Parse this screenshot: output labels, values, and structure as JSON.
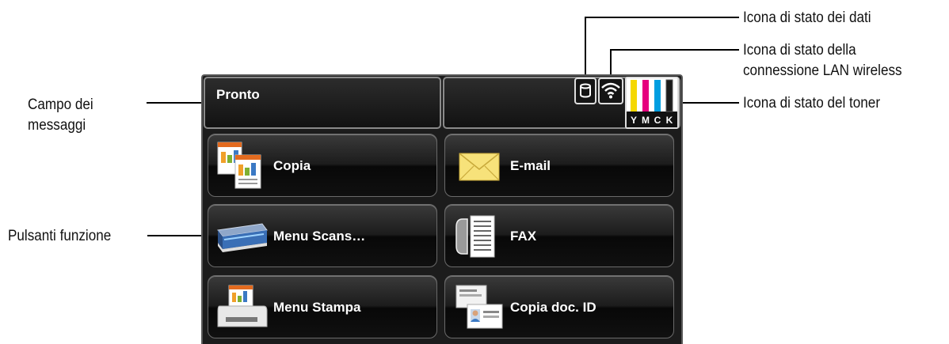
{
  "annotations": {
    "data_status": "Icona di stato dei dati",
    "wlan_status_line1": "Icona di stato della",
    "wlan_status_line2": "connessione LAN wireless",
    "toner_status": "Icona di stato del toner",
    "message_field_line1": "Campo dei",
    "message_field_line2": "messaggi",
    "function_buttons": "Pulsanti funzione"
  },
  "screen": {
    "message": "Pronto",
    "toner_letters": [
      "Y",
      "M",
      "C",
      "K"
    ],
    "toner_colors": [
      "#f5d800",
      "#e6007e",
      "#009ee0",
      "#1a1a1a"
    ],
    "buttons": [
      {
        "label": "Copia",
        "icon": "copy-icon"
      },
      {
        "label": "E-mail",
        "icon": "envelope-icon"
      },
      {
        "label": "Menu Scans…",
        "icon": "scanner-icon"
      },
      {
        "label": "FAX",
        "icon": "fax-icon"
      },
      {
        "label": "Menu Stampa",
        "icon": "printer-icon"
      },
      {
        "label": "Copia doc. ID",
        "icon": "id-card-icon"
      }
    ]
  }
}
